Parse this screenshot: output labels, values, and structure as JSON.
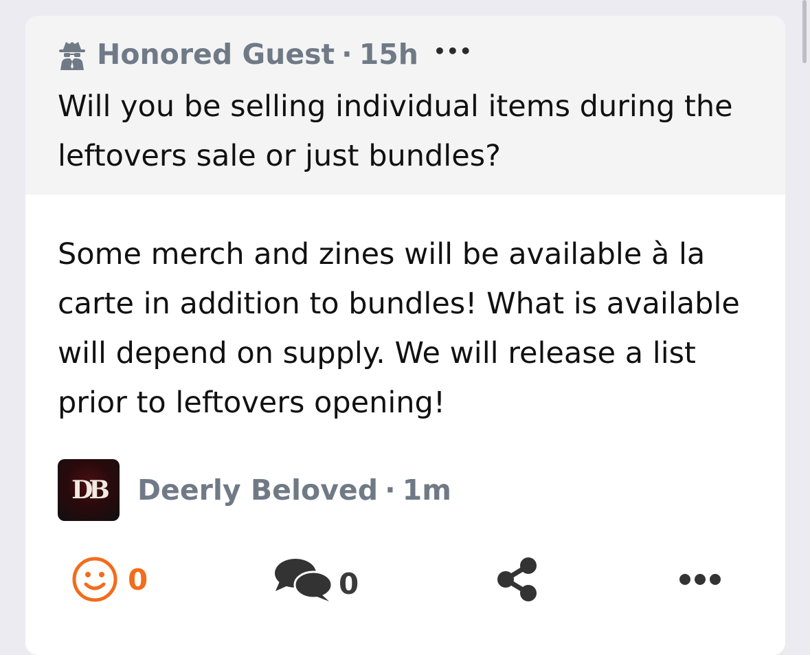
{
  "question": {
    "author": "Honored Guest",
    "separator": "·",
    "time": "15h",
    "menu": "•••",
    "text": "Will you be selling individual items during the leftovers sale or just bundles?"
  },
  "answer": {
    "text": "Some merch and zines will be available à la carte in addition to bundles! What is available will depend on supply. We will release a list prior to leftovers opening!",
    "author": "Deerly Beloved",
    "separator": "·",
    "time": "1m",
    "avatar_initials": "DB"
  },
  "actions": {
    "reactions_count": "0",
    "comments_count": "0",
    "more": "•••"
  },
  "icons": {
    "question_author": "spy-icon",
    "react": "smiley-icon",
    "comment": "comments-icon",
    "share": "share-icon",
    "more": "ellipsis-icon"
  },
  "colors": {
    "accent": "#f26c1b",
    "muted_text": "#707a86",
    "question_background": "#f4f4f5"
  }
}
